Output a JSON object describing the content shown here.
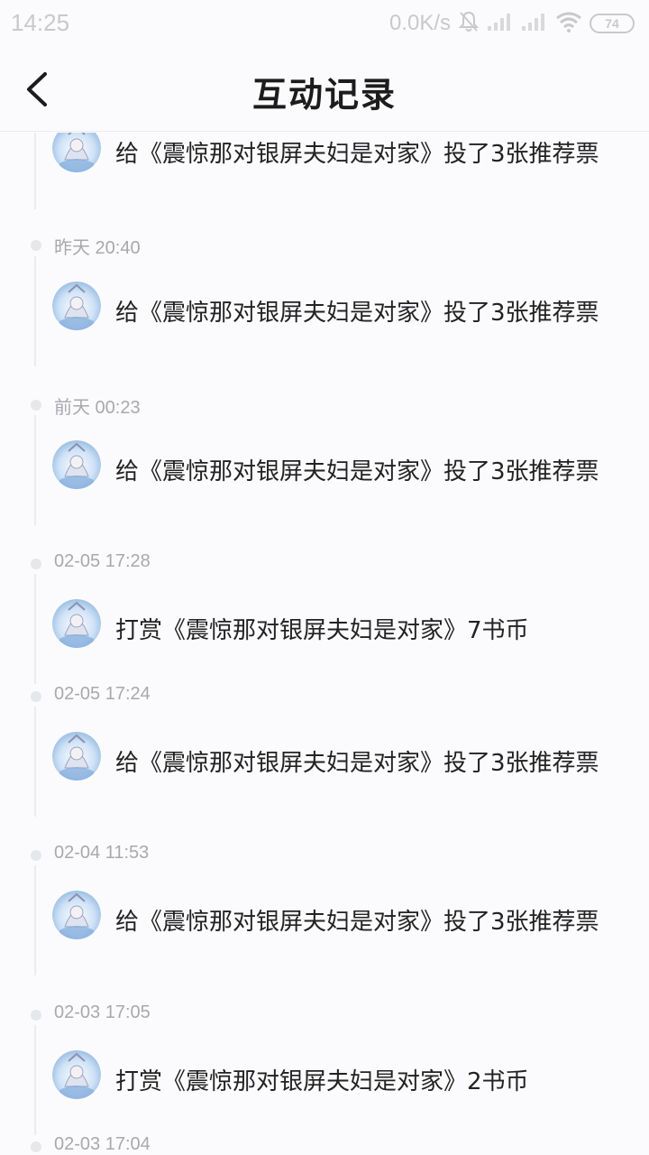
{
  "status_bar": {
    "time": "14:25",
    "net_speed": "0.0K/s",
    "battery": "74",
    "icons": [
      "bell-muted-icon",
      "signal-icon",
      "signal-icon",
      "wifi-icon",
      "battery-icon"
    ]
  },
  "header": {
    "back_icon": "chevron-left-icon",
    "title": "互动记录"
  },
  "records": [
    {
      "time": "",
      "text": "给《震惊那对银屏夫妇是对家》投了3张推荐票"
    },
    {
      "time": "昨天 20:40",
      "text": "给《震惊那对银屏夫妇是对家》投了3张推荐票"
    },
    {
      "time": "前天 00:23",
      "text": "给《震惊那对银屏夫妇是对家》投了3张推荐票"
    },
    {
      "time": "02-05 17:28",
      "text": "打赏《震惊那对银屏夫妇是对家》7书币"
    },
    {
      "time": "02-05 17:24",
      "text": "给《震惊那对银屏夫妇是对家》投了3张推荐票"
    },
    {
      "time": "02-04 11:53",
      "text": "给《震惊那对银屏夫妇是对家》投了3张推荐票"
    },
    {
      "time": "02-03 17:05",
      "text": "打赏《震惊那对银屏夫妇是对家》2书币"
    },
    {
      "time": "02-03 17:04",
      "text": ""
    }
  ],
  "colors": {
    "background": "#fbfbfd",
    "timestamp": "#a8a9ad",
    "timeline": "#ececef",
    "text": "#222222"
  }
}
